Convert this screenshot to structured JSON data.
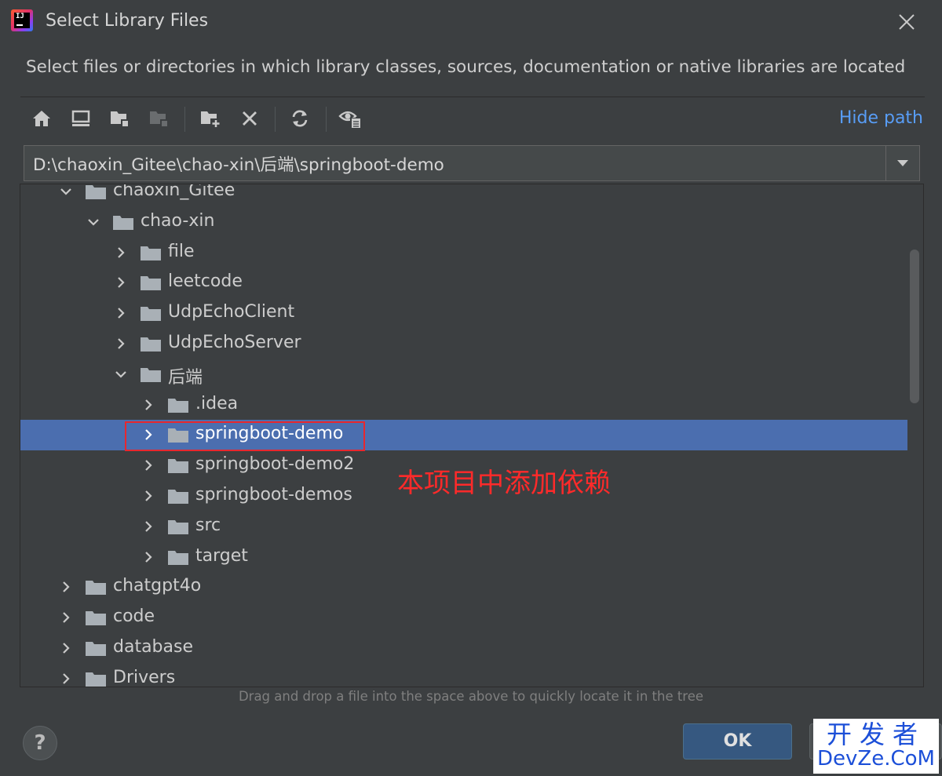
{
  "window": {
    "title": "Select Library Files",
    "description": "Select files or directories in which library classes, sources, documentation or native libraries are located",
    "logo_text": "IJ"
  },
  "toolbar": {
    "buttons": [
      {
        "name": "home-icon"
      },
      {
        "name": "desktop-icon"
      },
      {
        "name": "project-folder-icon"
      },
      {
        "name": "module-folder-icon"
      },
      {
        "name": "new-folder-icon"
      },
      {
        "name": "delete-icon"
      },
      {
        "name": "refresh-icon"
      },
      {
        "name": "show-hidden-files-icon"
      }
    ],
    "hide_path_label": "Hide path"
  },
  "path": {
    "value": "D:\\chaoxin_Gitee\\chao-xin\\后端\\springboot-demo"
  },
  "tree": {
    "items": [
      {
        "label": "chaoxin_Gitee",
        "depth": 0,
        "expanded": true
      },
      {
        "label": "chao-xin",
        "depth": 1,
        "expanded": true
      },
      {
        "label": "file",
        "depth": 2,
        "expanded": false
      },
      {
        "label": "leetcode",
        "depth": 2,
        "expanded": false
      },
      {
        "label": "UdpEchoClient",
        "depth": 2,
        "expanded": false
      },
      {
        "label": "UdpEchoServer",
        "depth": 2,
        "expanded": false
      },
      {
        "label": "后端",
        "depth": 2,
        "expanded": true
      },
      {
        "label": ".idea",
        "depth": 3,
        "expanded": false
      },
      {
        "label": "springboot-demo",
        "depth": 3,
        "expanded": false,
        "selected": true
      },
      {
        "label": "springboot-demo2",
        "depth": 3,
        "expanded": false
      },
      {
        "label": "springboot-demos",
        "depth": 3,
        "expanded": false
      },
      {
        "label": "src",
        "depth": 3,
        "expanded": false
      },
      {
        "label": "target",
        "depth": 3,
        "expanded": false
      },
      {
        "label": "chatgpt4o",
        "depth": 0,
        "expanded": false
      },
      {
        "label": "code",
        "depth": 0,
        "expanded": false
      },
      {
        "label": "database",
        "depth": 0,
        "expanded": false
      },
      {
        "label": "Drivers",
        "depth": 0,
        "expanded": false
      }
    ]
  },
  "annotation": "本项目中添加依赖",
  "drop_hint": "Drag and drop a file into the space above to quickly locate it in the tree",
  "footer": {
    "help_label": "?",
    "ok_label": "OK"
  },
  "watermark": {
    "line1": "开发者",
    "line2": "DevZe.CoM"
  },
  "colors": {
    "background": "#3c3f41",
    "selection": "#4b6eaf",
    "link": "#589df6",
    "annotation": "#ff2a2a",
    "ok_button": "#365880"
  }
}
